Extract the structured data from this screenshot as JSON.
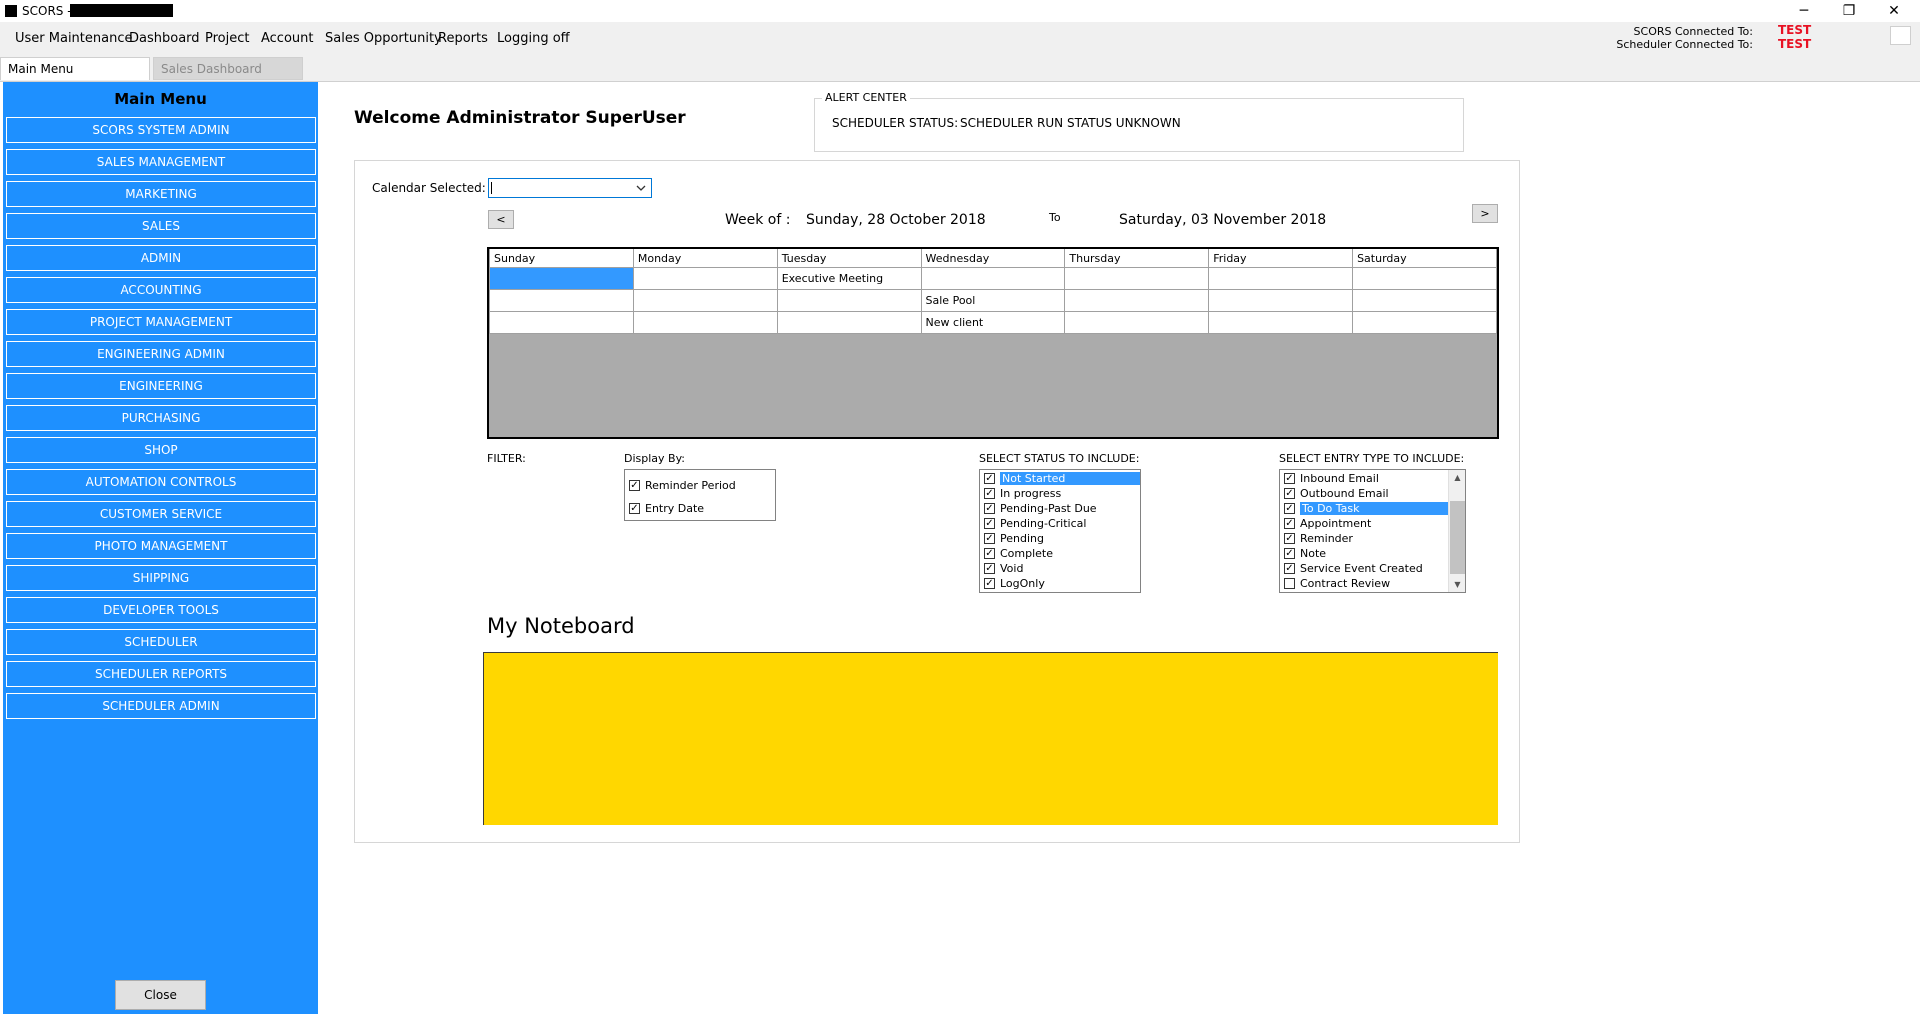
{
  "window": {
    "title": "SCORS -",
    "controls": {
      "minimize": "─",
      "restore": "❐",
      "close": "✕"
    }
  },
  "menubar": {
    "items": [
      "User Maintenance",
      "Dashboard",
      "Project",
      "Account",
      "Sales Opportunity",
      "Reports",
      "Logging off"
    ],
    "scors_connected_label": "SCORS Connected To:",
    "scors_connected_value": "TEST",
    "scheduler_connected_label": "Scheduler Connected To:",
    "scheduler_connected_value": "TEST"
  },
  "tabs": [
    {
      "label": "Main Menu",
      "active": true
    },
    {
      "label": "Sales Dashboard",
      "active": false
    }
  ],
  "sidebar": {
    "title": "Main Menu",
    "items": [
      "SCORS SYSTEM ADMIN",
      "SALES MANAGEMENT",
      "MARKETING",
      "SALES",
      "ADMIN",
      "ACCOUNTING",
      "PROJECT MANAGEMENT",
      "ENGINEERING ADMIN",
      "ENGINEERING",
      "PURCHASING",
      "SHOP",
      "AUTOMATION CONTROLS",
      "CUSTOMER SERVICE",
      "PHOTO MANAGEMENT",
      "SHIPPING",
      "DEVELOPER TOOLS",
      "SCHEDULER",
      "SCHEDULER REPORTS",
      "SCHEDULER ADMIN"
    ],
    "close_label": "Close",
    "background": "#1e90ff"
  },
  "main": {
    "welcome": "Welcome Administrator SuperUser",
    "alert": {
      "legend": "ALERT CENTER",
      "status_label": "SCHEDULER STATUS:",
      "status_value": "SCHEDULER RUN STATUS UNKNOWN"
    },
    "calendar": {
      "selected_label": "Calendar Selected:",
      "selected_value": "",
      "prev": "<",
      "next": ">",
      "week_of_label": "Week of :",
      "week_start": "Sunday, 28 October 2018",
      "to_label": "To",
      "week_end": "Saturday, 03 November 2018",
      "days": [
        "Sunday",
        "Monday",
        "Tuesday",
        "Wednesday",
        "Thursday",
        "Friday",
        "Saturday"
      ],
      "rows": [
        [
          "",
          "",
          "Executive Meeting",
          "",
          "",
          "",
          ""
        ],
        [
          "",
          "",
          "",
          "Sale Pool",
          "",
          "",
          ""
        ],
        [
          "",
          "",
          "",
          "New client",
          "",
          "",
          ""
        ]
      ]
    },
    "filter": {
      "label": "FILTER:",
      "display_by_label": "Display By:",
      "display_by": [
        {
          "label": "Reminder Period",
          "checked": true
        },
        {
          "label": "Entry Date",
          "checked": true
        }
      ],
      "status_label": "SELECT STATUS TO INCLUDE:",
      "statuses": [
        {
          "label": "Not Started",
          "checked": true,
          "selected": true
        },
        {
          "label": "In progress",
          "checked": true
        },
        {
          "label": "Pending-Past Due",
          "checked": true
        },
        {
          "label": "Pending-Critical",
          "checked": true
        },
        {
          "label": "Pending",
          "checked": true
        },
        {
          "label": "Complete",
          "checked": true
        },
        {
          "label": "Void",
          "checked": true
        },
        {
          "label": "LogOnly",
          "checked": true
        }
      ],
      "entry_type_label": "SELECT ENTRY TYPE TO INCLUDE:",
      "entry_types": [
        {
          "label": "Inbound Email",
          "checked": true
        },
        {
          "label": "Outbound Email",
          "checked": true
        },
        {
          "label": "To Do Task",
          "checked": true,
          "selected": true
        },
        {
          "label": "Appointment",
          "checked": true
        },
        {
          "label": "Reminder",
          "checked": true
        },
        {
          "label": "Note",
          "checked": true
        },
        {
          "label": "Service Event Created",
          "checked": true
        },
        {
          "label": "Contract Review",
          "checked": false
        }
      ],
      "scroll_up": "▲",
      "scroll_down": "▼"
    },
    "noteboard": {
      "title": "My Noteboard",
      "background": "#ffd700"
    }
  },
  "icons": {
    "checkmark": "✓",
    "dropdown": "chevron-down-icon"
  }
}
